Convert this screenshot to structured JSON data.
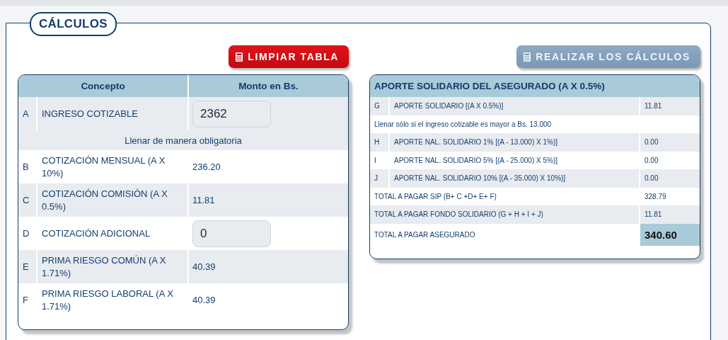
{
  "section": {
    "title": "CÁLCULOS"
  },
  "left": {
    "button": {
      "label": "LIMPIAR TABLA",
      "kind": "danger"
    },
    "columns": [
      "Concepto",
      "Monto en Bs."
    ],
    "rows": [
      {
        "kind": "input",
        "letter": "A",
        "concept": "INGRESO COTIZABLE",
        "value": "2362"
      },
      {
        "kind": "note",
        "text": "Llenar de manera obligatoria"
      },
      {
        "kind": "value",
        "letter": "B",
        "concept": "COTIZACIÓN MENSUAL (A X 10%)",
        "value": "236.20"
      },
      {
        "kind": "value",
        "letter": "C",
        "concept": "COTIZACIÓN COMISIÓN (A X 0.5%)",
        "value": "11.81"
      },
      {
        "kind": "input",
        "letter": "D",
        "concept": "COTIZACIÓN ADICIONAL",
        "value": "0"
      },
      {
        "kind": "value",
        "letter": "E",
        "concept": "PRIMA RIESGO COMÚN (A X 1.71%)",
        "value": "40.39"
      },
      {
        "kind": "value",
        "letter": "F",
        "concept": "PRIMA RIESGO LABORAL (A X 1.71%)",
        "value": "40.39"
      }
    ]
  },
  "right": {
    "button": {
      "label": "REALIZAR LOS CÁLCULOS",
      "kind": "secondary"
    },
    "title": "APORTE SOLIDARIO DEL ASEGURADO (A X 0.5%)",
    "rows": [
      {
        "kind": "item",
        "letter": "G",
        "concept": "APORTE SOLIDARIO [(A X 0.5%)]",
        "value": "11.81"
      },
      {
        "kind": "note",
        "text": "Llenar sólo si el ingreso cotizable es mayor a Bs. 13.000"
      },
      {
        "kind": "item",
        "letter": "H",
        "concept": "APORTE NAL. SOLIDARIO 1% [(A - 13.000) X 1%)]",
        "value": "0.00"
      },
      {
        "kind": "item",
        "letter": "I",
        "concept": "APORTE NAL. SOLIDARIO 5% [(A - 25.000) X 5%)]",
        "value": "0.00"
      },
      {
        "kind": "item",
        "letter": "J",
        "concept": "APORTE NAL. SOLIDARIO 10% [(A - 35.000) X 10%)]",
        "value": "0.00"
      },
      {
        "kind": "total",
        "concept": "TOTAL A PAGAR SIP (B+ C +D+ E+ F)",
        "value": "328.79"
      },
      {
        "kind": "total",
        "concept": "TOTAL A PAGAR FONDO SOLIDARIO (G + H + I + J)",
        "value": "11.81"
      },
      {
        "kind": "grand",
        "concept": "TOTAL A PAGAR ASEGURADO",
        "value": "340.60"
      }
    ]
  }
}
